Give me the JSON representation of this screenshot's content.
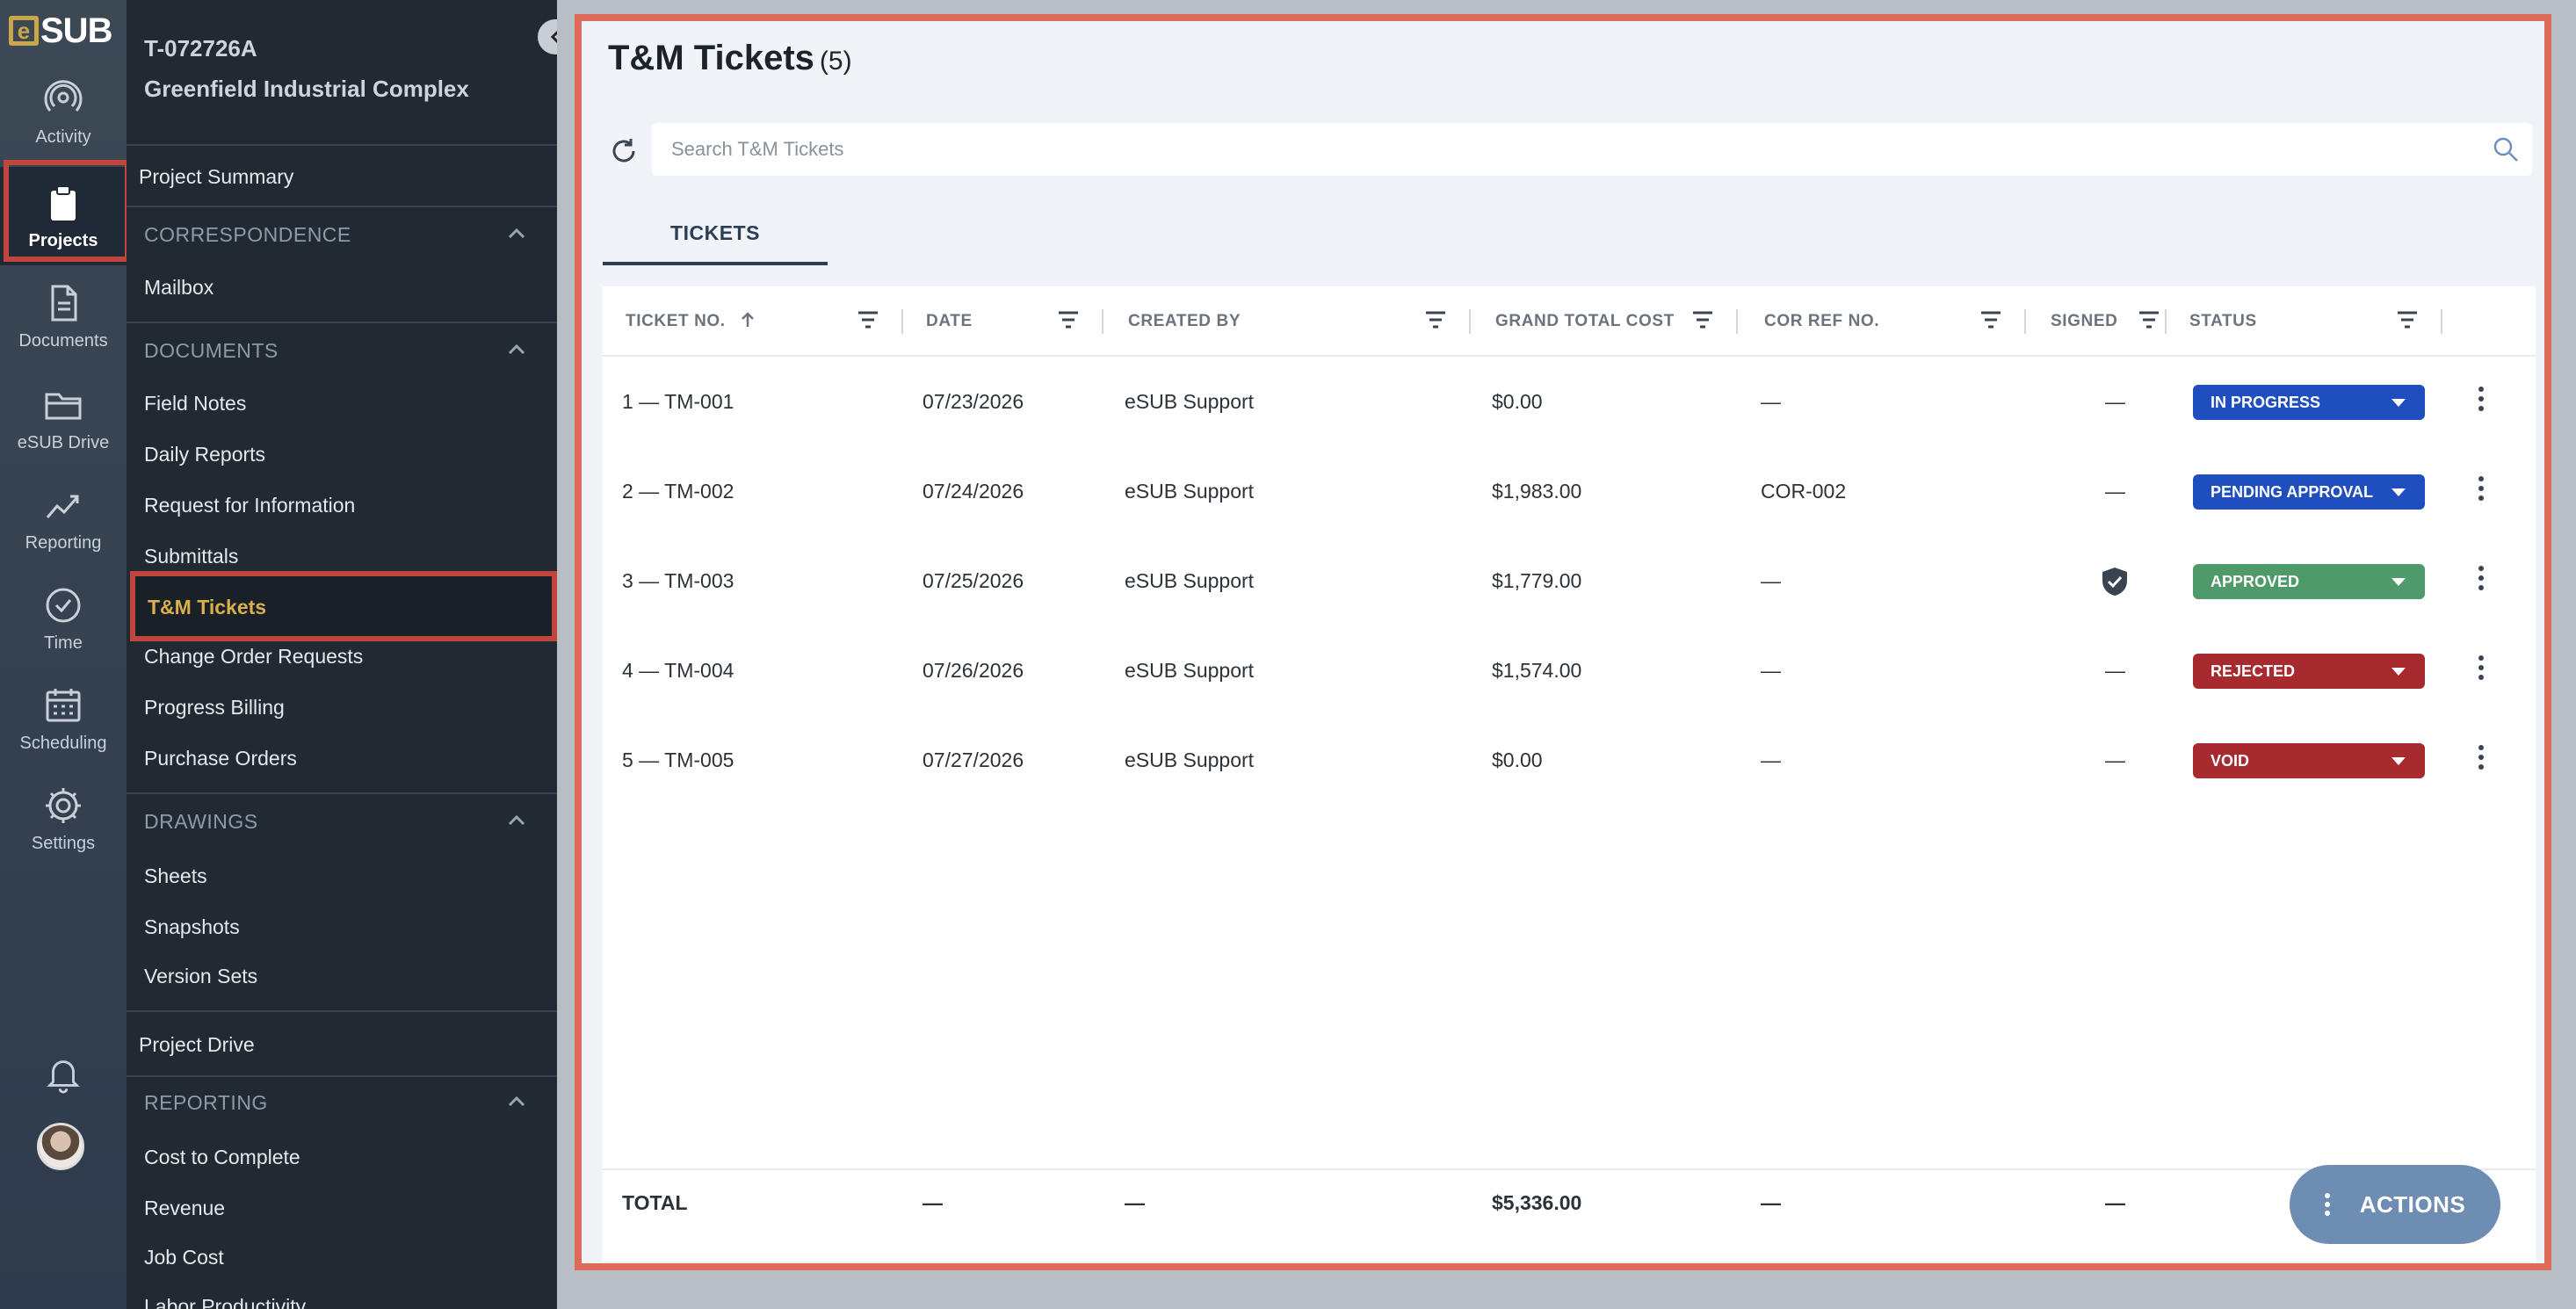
{
  "brand": {
    "logo_letter": "e",
    "logo_text": "SUB",
    "logo_color": "#c9a64a"
  },
  "rail": {
    "items": [
      {
        "label": "Activity",
        "icon": "activity-icon",
        "active": false
      },
      {
        "label": "Projects",
        "icon": "clipboard-icon",
        "active": true
      },
      {
        "label": "Documents",
        "icon": "document-icon",
        "active": false
      },
      {
        "label": "eSUB Drive",
        "icon": "folder-icon",
        "active": false
      },
      {
        "label": "Reporting",
        "icon": "chart-line-icon",
        "active": false
      },
      {
        "label": "Time",
        "icon": "clock-icon",
        "active": false
      },
      {
        "label": "Scheduling",
        "icon": "calendar-icon",
        "active": false
      },
      {
        "label": "Settings",
        "icon": "gear-icon",
        "active": false
      }
    ],
    "bottom": {
      "notifications_icon": "bell-icon",
      "avatar": "user-avatar"
    }
  },
  "project": {
    "id": "T-072726A",
    "name": "Greenfield Industrial Complex"
  },
  "nav": {
    "project_summary": "Project Summary",
    "correspondence": {
      "title": "CORRESPONDENCE",
      "items": [
        "Mailbox"
      ]
    },
    "documents": {
      "title": "DOCUMENTS",
      "items": [
        "Field Notes",
        "Daily Reports",
        "Request for Information",
        "Submittals",
        "T&M Tickets",
        "Change Order Requests",
        "Progress Billing",
        "Purchase Orders"
      ]
    },
    "drawings": {
      "title": "DRAWINGS",
      "items": [
        "Sheets",
        "Snapshots",
        "Version Sets"
      ]
    },
    "project_drive": "Project Drive",
    "reporting": {
      "title": "REPORTING",
      "items": [
        "Cost to Complete",
        "Revenue",
        "Job Cost",
        "Labor Productivity"
      ]
    },
    "active_item": "T&M Tickets"
  },
  "page": {
    "title": "T&M Tickets",
    "count": "(5)",
    "search_placeholder": "Search T&M Tickets",
    "tab": "TICKETS"
  },
  "table": {
    "columns": {
      "ticket_no": "TICKET NO.",
      "date": "DATE",
      "created_by": "CREATED BY",
      "grand_total_cost": "GRAND TOTAL COST",
      "cor_ref_no": "COR REF NO.",
      "signed": "SIGNED",
      "status": "STATUS"
    },
    "rows": [
      {
        "ticket": "1 — TM-001",
        "date": "07/23/2026",
        "created_by": "eSUB Support",
        "cost": "$0.00",
        "cor": "—",
        "signed": "—",
        "status": "IN PROGRESS",
        "status_color": "#1f4fbf"
      },
      {
        "ticket": "2 — TM-002",
        "date": "07/24/2026",
        "created_by": "eSUB Support",
        "cost": "$1,983.00",
        "cor": "COR-002",
        "signed": "—",
        "status": "PENDING APPROVAL",
        "status_color": "#1f4fbf"
      },
      {
        "ticket": "3 — TM-003",
        "date": "07/25/2026",
        "created_by": "eSUB Support",
        "cost": "$1,779.00",
        "cor": "—",
        "signed": "shield-check-icon",
        "status": "APPROVED",
        "status_color": "#4f9a6a"
      },
      {
        "ticket": "4 — TM-004",
        "date": "07/26/2026",
        "created_by": "eSUB Support",
        "cost": "$1,574.00",
        "cor": "—",
        "signed": "—",
        "status": "REJECTED",
        "status_color": "#a72a2e"
      },
      {
        "ticket": "5 — TM-005",
        "date": "07/27/2026",
        "created_by": "eSUB Support",
        "cost": "$0.00",
        "cor": "—",
        "signed": "—",
        "status": "VOID",
        "status_color": "#a72a2e"
      }
    ],
    "totals": {
      "label": "TOTAL",
      "date": "—",
      "created_by": "—",
      "cost": "$5,336.00",
      "cor": "—",
      "signed": "—"
    }
  },
  "actions_label": "ACTIONS"
}
